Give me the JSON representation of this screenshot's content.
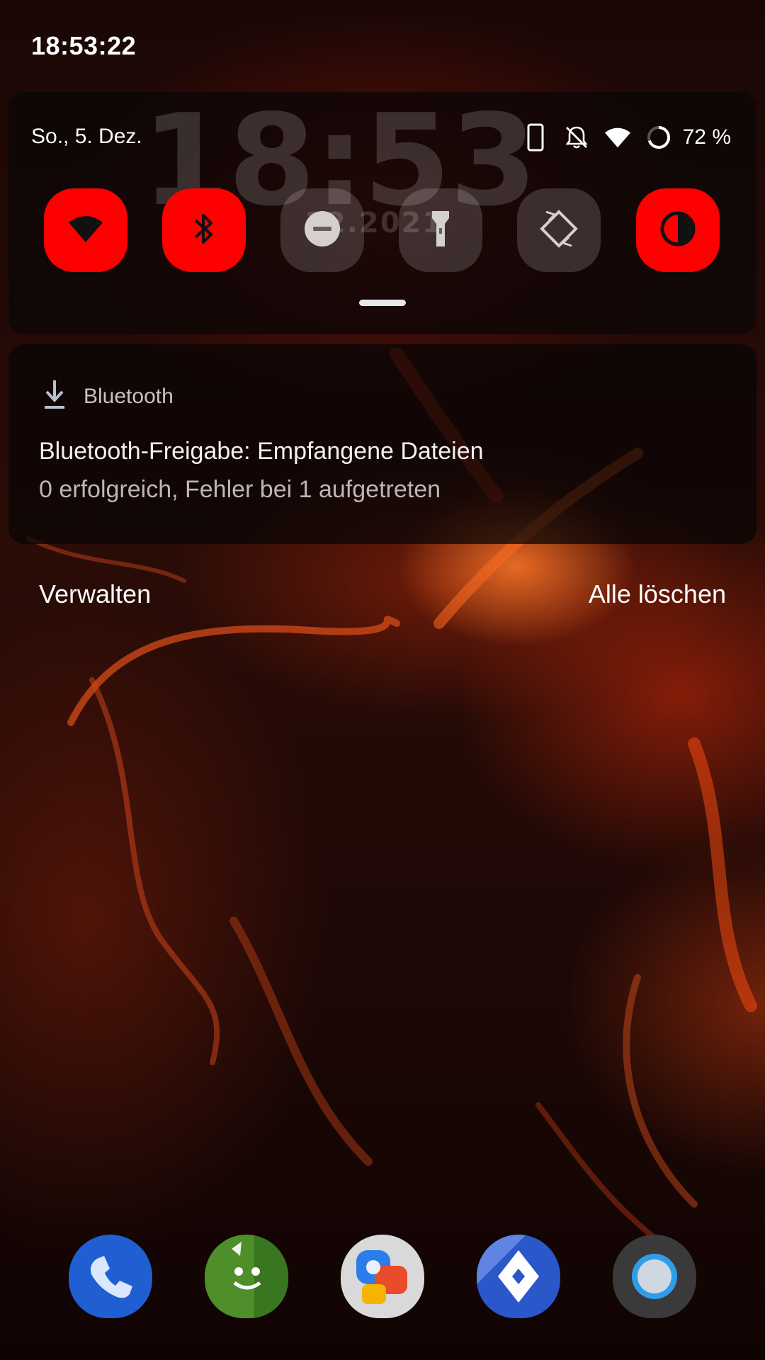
{
  "status_bar": {
    "time": "18:53:22"
  },
  "lock_overlay": {
    "clock": "18:53",
    "date": "12.2021"
  },
  "quick_settings": {
    "date": "So., 5. Dez.",
    "status_icons": [
      "phone-portrait-icon",
      "notifications-off-icon",
      "wifi-signal-icon",
      "battery-ring-icon"
    ],
    "battery_percent": "72 %",
    "tiles": [
      {
        "name": "wifi",
        "icon": "wifi-icon",
        "state": "on"
      },
      {
        "name": "bluetooth",
        "icon": "bluetooth-icon",
        "state": "on"
      },
      {
        "name": "do-not-disturb",
        "icon": "do-not-disturb-icon",
        "state": "off"
      },
      {
        "name": "flashlight",
        "icon": "flashlight-icon",
        "state": "off"
      },
      {
        "name": "auto-rotate",
        "icon": "auto-rotate-icon",
        "state": "off"
      },
      {
        "name": "dark-theme",
        "icon": "contrast-icon",
        "state": "on"
      }
    ],
    "accent_color": "#ff0000"
  },
  "notification": {
    "app_icon": "download-icon",
    "app_name": "Bluetooth",
    "title": "Bluetooth-Freigabe: Empfangene Dateien",
    "text": "0 erfolgreich, Fehler bei 1 aufgetreten"
  },
  "actions": {
    "manage": "Verwalten",
    "clear_all": "Alle löschen"
  },
  "dock": [
    {
      "name": "phone",
      "icon": "phone-icon",
      "color": "#1f5fd1"
    },
    {
      "name": "messages",
      "icon": "messages-icon",
      "color": "#4f8f2a"
    },
    {
      "name": "contacts-duo",
      "icon": "contacts-chat-icon",
      "color": "#d9d9d9"
    },
    {
      "name": "maps-go",
      "icon": "navigation-icon",
      "color": "#2a57c9"
    },
    {
      "name": "camera",
      "icon": "camera-lens-icon",
      "color": "#3a3a3a"
    }
  ]
}
